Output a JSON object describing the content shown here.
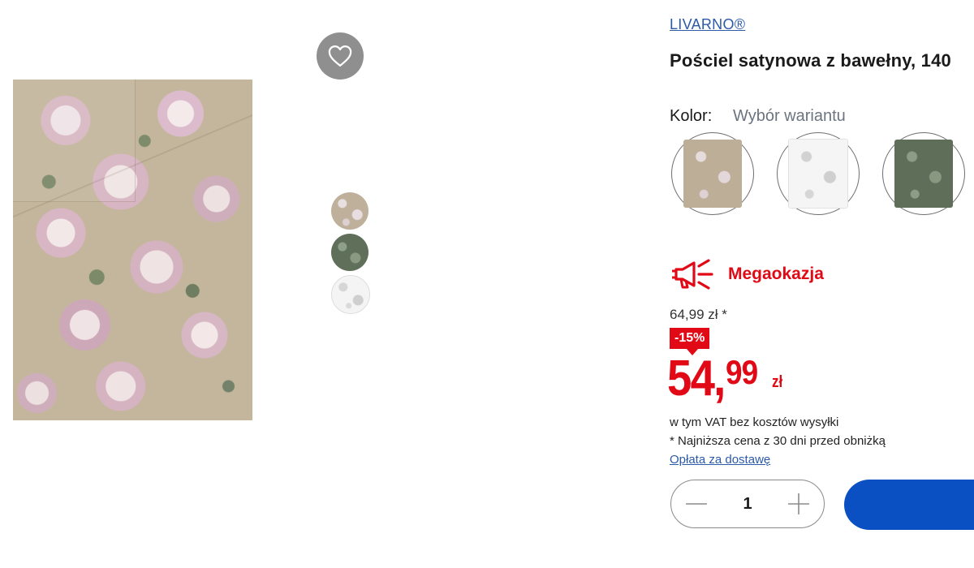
{
  "product": {
    "brand": "LIVARNO®",
    "title": "Pościel satynowa z bawełny, 140"
  },
  "variant": {
    "label": "Kolor:",
    "value": "Wybór wariantu",
    "swatches": [
      "beige-floral",
      "white-floral",
      "green-floral"
    ]
  },
  "gallery": {
    "thumbnails": [
      "beige-floral",
      "green-floral",
      "white-floral"
    ]
  },
  "promo": {
    "label": "Megaokazja",
    "icon": "megaphone-icon",
    "color": "#e10915"
  },
  "pricing": {
    "old_price": "64,99 zł *",
    "discount": "-15%",
    "price_main": "54,",
    "price_decimal": "99",
    "currency": "zł",
    "vat_note": "w tym VAT bez kosztów wysyłki",
    "lowest_note": "* Najniższa cena z 30 dni przed obniżką",
    "shipping_link": "Opłata za dostawę"
  },
  "cart": {
    "quantity": "1",
    "button_color": "#0a50c2"
  },
  "colors": {
    "link": "#2c5aa8",
    "accent_red": "#e10915"
  }
}
